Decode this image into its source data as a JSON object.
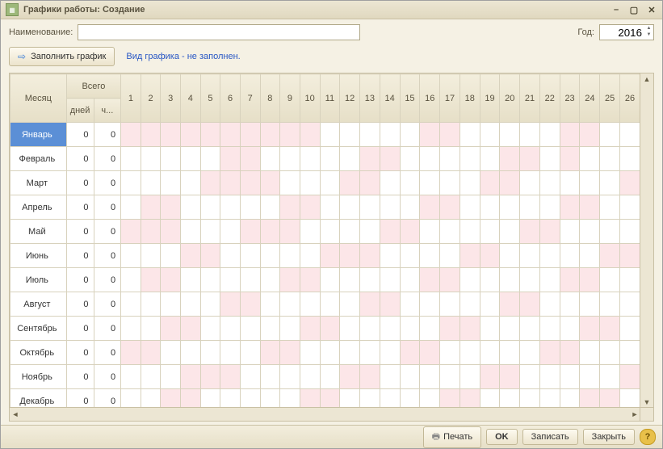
{
  "window": {
    "title": "Графики работы: Создание"
  },
  "form": {
    "name_label": "Наименование:",
    "name_value": "",
    "year_label": "Год:",
    "year_value": "2016",
    "fill_button": "Заполнить график",
    "info": "Вид графика - не заполнен."
  },
  "grid": {
    "month_header": "Месяц",
    "total_header": "Всего",
    "days_header": "дней",
    "hours_header": "ч...",
    "day_numbers": [
      "1",
      "2",
      "3",
      "4",
      "5",
      "6",
      "7",
      "8",
      "9",
      "10",
      "11",
      "12",
      "13",
      "14",
      "15",
      "16",
      "17",
      "18",
      "19",
      "20",
      "21",
      "22",
      "23",
      "24",
      "25",
      "26"
    ],
    "months": [
      {
        "name": "Январь",
        "days": 0,
        "hours": 0,
        "selected": true,
        "weekend": [
          0,
          1,
          2,
          3,
          4,
          5,
          6,
          7,
          8,
          9,
          15,
          16,
          22,
          23
        ]
      },
      {
        "name": "Февраль",
        "days": 0,
        "hours": 0,
        "weekend": [
          5,
          6,
          12,
          13,
          19,
          20,
          22
        ]
      },
      {
        "name": "Март",
        "days": 0,
        "hours": 0,
        "weekend": [
          4,
          5,
          6,
          7,
          11,
          12,
          18,
          19,
          25
        ]
      },
      {
        "name": "Апрель",
        "days": 0,
        "hours": 0,
        "weekend": [
          1,
          2,
          8,
          9,
          15,
          16,
          22,
          23
        ]
      },
      {
        "name": "Май",
        "days": 0,
        "hours": 0,
        "weekend": [
          0,
          1,
          2,
          6,
          7,
          8,
          13,
          14,
          20,
          21
        ]
      },
      {
        "name": "Июнь",
        "days": 0,
        "hours": 0,
        "weekend": [
          3,
          4,
          10,
          11,
          12,
          17,
          18,
          24,
          25
        ]
      },
      {
        "name": "Июль",
        "days": 0,
        "hours": 0,
        "weekend": [
          1,
          2,
          8,
          9,
          15,
          16,
          22,
          23
        ]
      },
      {
        "name": "Август",
        "days": 0,
        "hours": 0,
        "weekend": [
          5,
          6,
          12,
          13,
          19,
          20
        ]
      },
      {
        "name": "Сентябрь",
        "days": 0,
        "hours": 0,
        "weekend": [
          2,
          3,
          9,
          10,
          16,
          17,
          23,
          24
        ]
      },
      {
        "name": "Октябрь",
        "days": 0,
        "hours": 0,
        "weekend": [
          0,
          1,
          7,
          8,
          14,
          15,
          21,
          22
        ]
      },
      {
        "name": "Ноябрь",
        "days": 0,
        "hours": 0,
        "weekend": [
          3,
          4,
          5,
          11,
          12,
          18,
          19,
          25
        ]
      },
      {
        "name": "Декабрь",
        "days": 0,
        "hours": 0,
        "weekend": [
          2,
          3,
          9,
          10,
          16,
          17,
          23,
          24
        ]
      }
    ]
  },
  "footer": {
    "print": "Печать",
    "ok": "OK",
    "save": "Записать",
    "close": "Закрыть"
  }
}
